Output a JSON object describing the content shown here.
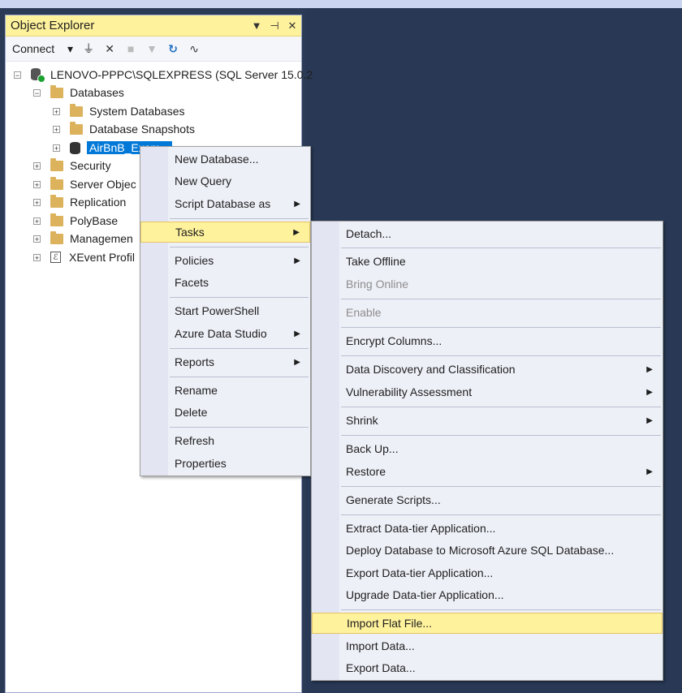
{
  "object_explorer": {
    "title": "Object Explorer",
    "controls": {
      "dropdown": "▾",
      "pin": "📌",
      "close": "✕"
    },
    "toolbar": {
      "connect_label": "Connect"
    },
    "tree": {
      "server": "LENOVO-PPPC\\SQLEXPRESS (SQL Server 15.0.2",
      "databases": "Databases",
      "system_databases": "System Databases",
      "database_snapshots": "Database Snapshots",
      "selected_db": "AirBnB_Exam...",
      "security": "Security",
      "server_objects": "Server Objec",
      "replication": "Replication",
      "polybase": "PolyBase",
      "management": "Managemen",
      "xevent": "XEvent Profil"
    }
  },
  "context_menu": {
    "items": [
      {
        "label": "New Database..."
      },
      {
        "label": "New Query"
      },
      {
        "label": "Script Database as"
      },
      {
        "label": "Tasks"
      },
      {
        "label": "Policies"
      },
      {
        "label": "Facets"
      },
      {
        "label": "Start PowerShell"
      },
      {
        "label": "Azure Data Studio"
      },
      {
        "label": "Reports"
      },
      {
        "label": "Rename"
      },
      {
        "label": "Delete"
      },
      {
        "label": "Refresh"
      },
      {
        "label": "Properties"
      }
    ]
  },
  "tasks_menu": {
    "items": [
      {
        "label": "Detach..."
      },
      {
        "label": "Take Offline"
      },
      {
        "label": "Bring Online"
      },
      {
        "label": "Enable"
      },
      {
        "label": "Encrypt Columns..."
      },
      {
        "label": "Data Discovery and Classification"
      },
      {
        "label": "Vulnerability Assessment"
      },
      {
        "label": "Shrink"
      },
      {
        "label": "Back Up..."
      },
      {
        "label": "Restore"
      },
      {
        "label": "Generate Scripts..."
      },
      {
        "label": "Extract Data-tier Application..."
      },
      {
        "label": "Deploy Database to Microsoft Azure SQL Database..."
      },
      {
        "label": "Export Data-tier Application..."
      },
      {
        "label": "Upgrade Data-tier Application..."
      },
      {
        "label": "Import Flat File..."
      },
      {
        "label": "Import Data..."
      },
      {
        "label": "Export Data..."
      }
    ]
  },
  "colors": {
    "highlight": "#fff29d",
    "selection": "#0078d7",
    "background": "#293955"
  }
}
